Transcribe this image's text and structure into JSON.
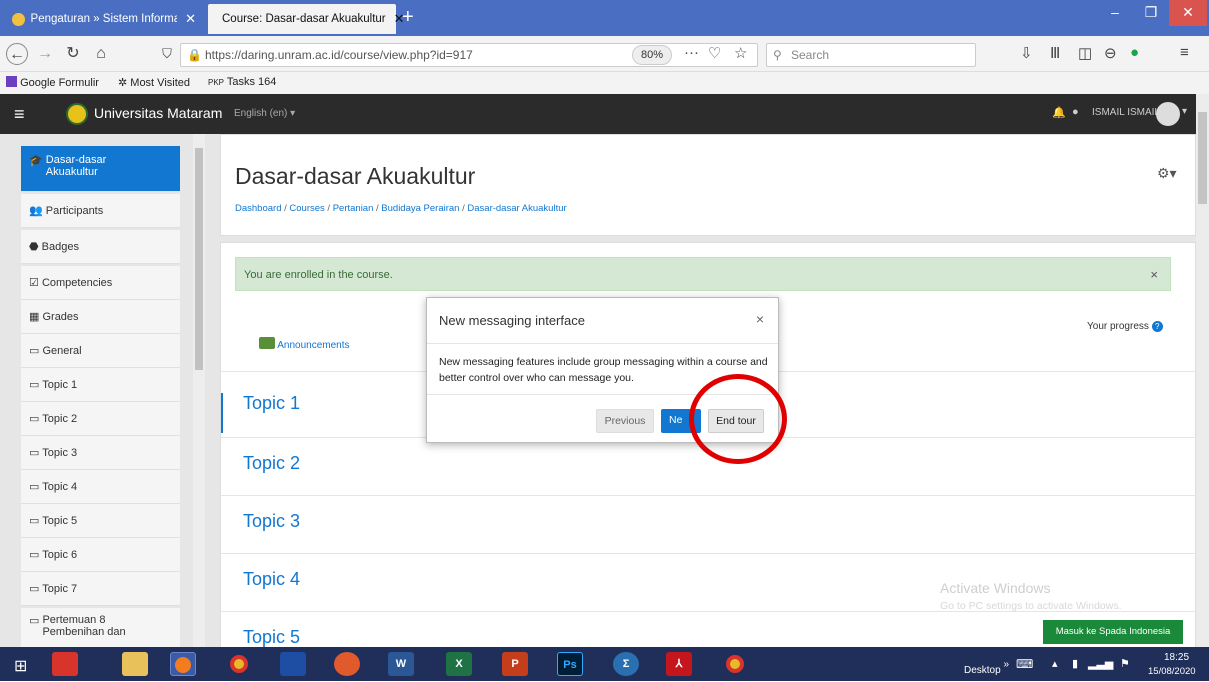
{
  "browser": {
    "tabs": [
      {
        "label": "Pengaturan » Sistem Informasi",
        "close": "✕"
      },
      {
        "label": "Course: Dasar-dasar Akuakultur",
        "close": "✕"
      }
    ],
    "new_tab": "+",
    "window_controls": {
      "minimize": "–",
      "maximize": "❐",
      "close": "✕"
    },
    "url": "https://daring.unram.ac.id/course/view.php?id=917",
    "zoom": "80%",
    "page_actions": "···",
    "search_placeholder": "Search",
    "bookmarks": [
      "Google Formulir",
      "Most Visited",
      "Tasks 164"
    ],
    "bookmark_prefix": "PKP"
  },
  "moodle_nav": {
    "menu_icon": "≡",
    "site_name": "Universitas Mataram",
    "language": "English (en) ▾",
    "user_name": "ISMAIL ISMAIL"
  },
  "drawer": {
    "items": [
      {
        "icon": "🎓",
        "label": "Dasar-dasar Akuakultur"
      },
      {
        "icon": "👥",
        "label": "Participants"
      },
      {
        "icon": "⬣",
        "label": "Badges"
      },
      {
        "icon": "☑",
        "label": "Competencies"
      },
      {
        "icon": "▦",
        "label": "Grades"
      },
      {
        "icon": "▭",
        "label": "General"
      },
      {
        "icon": "▭",
        "label": "Topic 1"
      },
      {
        "icon": "▭",
        "label": "Topic 2"
      },
      {
        "icon": "▭",
        "label": "Topic 3"
      },
      {
        "icon": "▭",
        "label": "Topic 4"
      },
      {
        "icon": "▭",
        "label": "Topic 5"
      },
      {
        "icon": "▭",
        "label": "Topic 6"
      },
      {
        "icon": "▭",
        "label": "Topic 7"
      },
      {
        "icon": "▭",
        "label": "Pertemuan 8 Pembenihan dan"
      }
    ]
  },
  "course": {
    "title": "Dasar-dasar Akuakultur",
    "breadcrumb": [
      "Dashboard",
      "Courses",
      "Pertanian",
      "Budidaya Perairan",
      "Dasar-dasar Akuakultur"
    ],
    "breadcrumb_sep": "/",
    "gear": "⚙▾",
    "alert": "You are enrolled in the course.",
    "alert_close": "×",
    "progress_label": "Your progress",
    "announcements": "Announcements",
    "topics": [
      "Topic 1",
      "Topic 2",
      "Topic 3",
      "Topic 4",
      "Topic 5"
    ]
  },
  "modal": {
    "title": "New messaging interface",
    "close": "×",
    "body": "New messaging features include group messaging within a course and better control over who can message you.",
    "previous": "Previous",
    "next": "Ne",
    "end_tour": "End tour"
  },
  "watermark": {
    "line1": "Activate Windows",
    "line2": "Go to PC settings to activate Windows."
  },
  "spada_button": "Masuk ke Spada Indonesia",
  "taskbar": {
    "desktop_label": "Desktop",
    "chevrons": "»",
    "time": "18:25",
    "date": "15/08/2020"
  },
  "colors": {
    "tab_bar": "#4a6fc2",
    "moodle_nav": "#2b2b2b",
    "primary": "#1177d1",
    "alert_bg": "#d5e8d4",
    "annotation_red": "#e00000",
    "spada_green": "#1a8a3a",
    "taskbar": "#1f2f5a"
  }
}
